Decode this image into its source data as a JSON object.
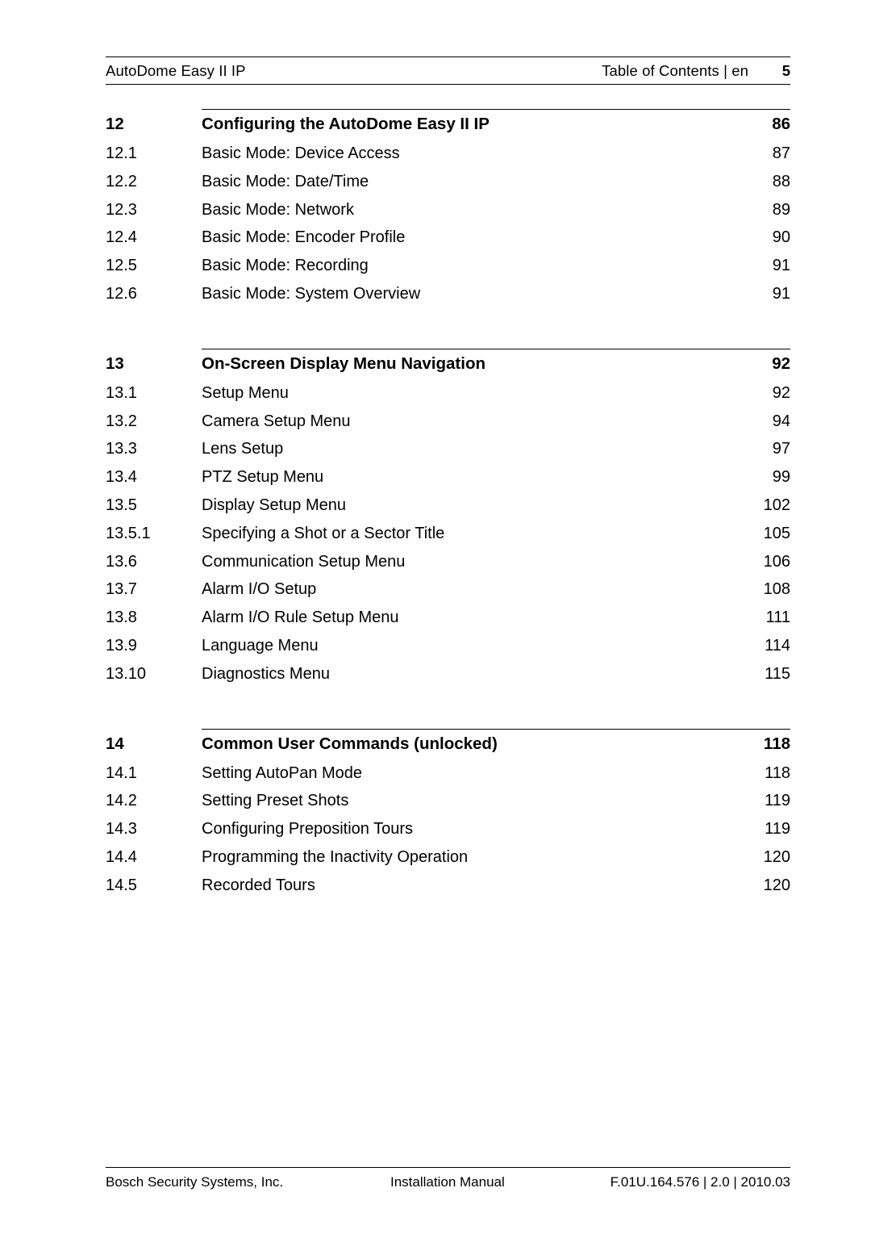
{
  "header": {
    "product": "AutoDome Easy II IP",
    "breadcrumb": "Table of Contents | en",
    "page_number": "5"
  },
  "toc": {
    "sections": [
      {
        "number": "12",
        "title": "Configuring the AutoDome Easy II IP",
        "page": "86",
        "entries": [
          {
            "number": "12.1",
            "title": "Basic Mode: Device Access",
            "page": "87"
          },
          {
            "number": "12.2",
            "title": "Basic Mode: Date/Time",
            "page": "88"
          },
          {
            "number": "12.3",
            "title": "Basic Mode: Network",
            "page": "89"
          },
          {
            "number": "12.4",
            "title": "Basic Mode: Encoder Profile",
            "page": "90"
          },
          {
            "number": "12.5",
            "title": "Basic Mode: Recording",
            "page": "91"
          },
          {
            "number": "12.6",
            "title": "Basic Mode: System Overview",
            "page": "91"
          }
        ]
      },
      {
        "number": "13",
        "title": "On-Screen Display Menu Navigation",
        "page": "92",
        "entries": [
          {
            "number": "13.1",
            "title": "Setup Menu",
            "page": "92"
          },
          {
            "number": "13.2",
            "title": "Camera Setup Menu",
            "page": "94"
          },
          {
            "number": "13.3",
            "title": "Lens Setup",
            "page": "97"
          },
          {
            "number": "13.4",
            "title": "PTZ Setup Menu",
            "page": "99"
          },
          {
            "number": "13.5",
            "title": "Display Setup Menu",
            "page": "102"
          },
          {
            "number": "13.5.1",
            "title": "Specifying a Shot or a Sector Title",
            "page": "105"
          },
          {
            "number": "13.6",
            "title": "Communication Setup Menu",
            "page": "106"
          },
          {
            "number": "13.7",
            "title": "Alarm I/O Setup",
            "page": "108"
          },
          {
            "number": "13.8",
            "title": "Alarm I/O Rule Setup Menu",
            "page": "111"
          },
          {
            "number": "13.9",
            "title": "Language Menu",
            "page": "114"
          },
          {
            "number": "13.10",
            "title": "Diagnostics Menu",
            "page": "115"
          }
        ]
      },
      {
        "number": "14",
        "title": "Common User Commands (unlocked)",
        "page": "118",
        "entries": [
          {
            "number": "14.1",
            "title": "Setting AutoPan Mode",
            "page": "118"
          },
          {
            "number": "14.2",
            "title": "Setting Preset Shots",
            "page": "119"
          },
          {
            "number": "14.3",
            "title": "Configuring Preposition Tours",
            "page": "119"
          },
          {
            "number": "14.4",
            "title": "Programming the Inactivity Operation",
            "page": "120"
          },
          {
            "number": "14.5",
            "title": "Recorded Tours",
            "page": "120"
          }
        ]
      }
    ]
  },
  "footer": {
    "company": "Bosch Security Systems, Inc.",
    "document_type": "Installation Manual",
    "document_id": "F.01U.164.576 | 2.0 | 2010.03"
  },
  "colors": {
    "text": "#000000",
    "rule": "#000000",
    "background": "#ffffff"
  }
}
